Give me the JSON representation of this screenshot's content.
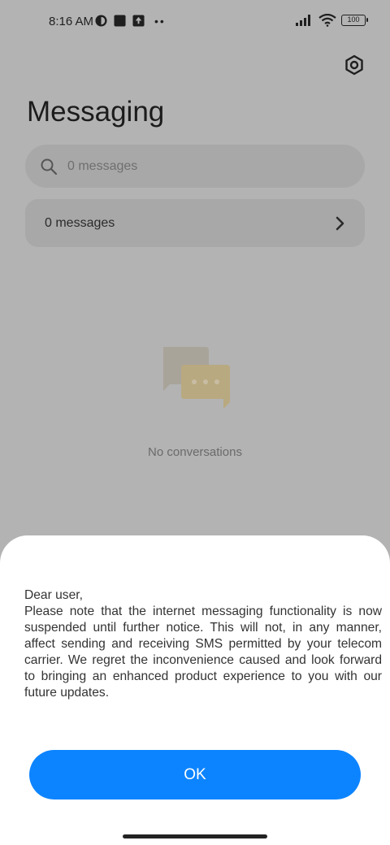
{
  "status_bar": {
    "time": "8:16 AM",
    "battery": "100"
  },
  "header": {
    "title": "Messaging"
  },
  "search": {
    "placeholder": "0 messages"
  },
  "messages_row": {
    "label": "0 messages"
  },
  "empty_state": {
    "label": "No conversations"
  },
  "dialog": {
    "greeting": "Dear user,",
    "body": "Please note that the internet messaging functionality is now suspended until further notice. This will not, in any manner, affect sending and receiving SMS permitted by your telecom carrier. We regret the inconvenience caused and look forward to bringing an enhanced product experience to you with our future updates.",
    "ok_label": "OK"
  },
  "colors": {
    "accent": "#0d84ff",
    "scrim_background": "#b3b3b3",
    "sheet_background": "#ffffff"
  },
  "icons": [
    "settings-icon",
    "search-icon",
    "chevron-right-icon",
    "chat-bubbles-icon",
    "signal-icon",
    "wifi-icon",
    "battery-icon"
  ]
}
